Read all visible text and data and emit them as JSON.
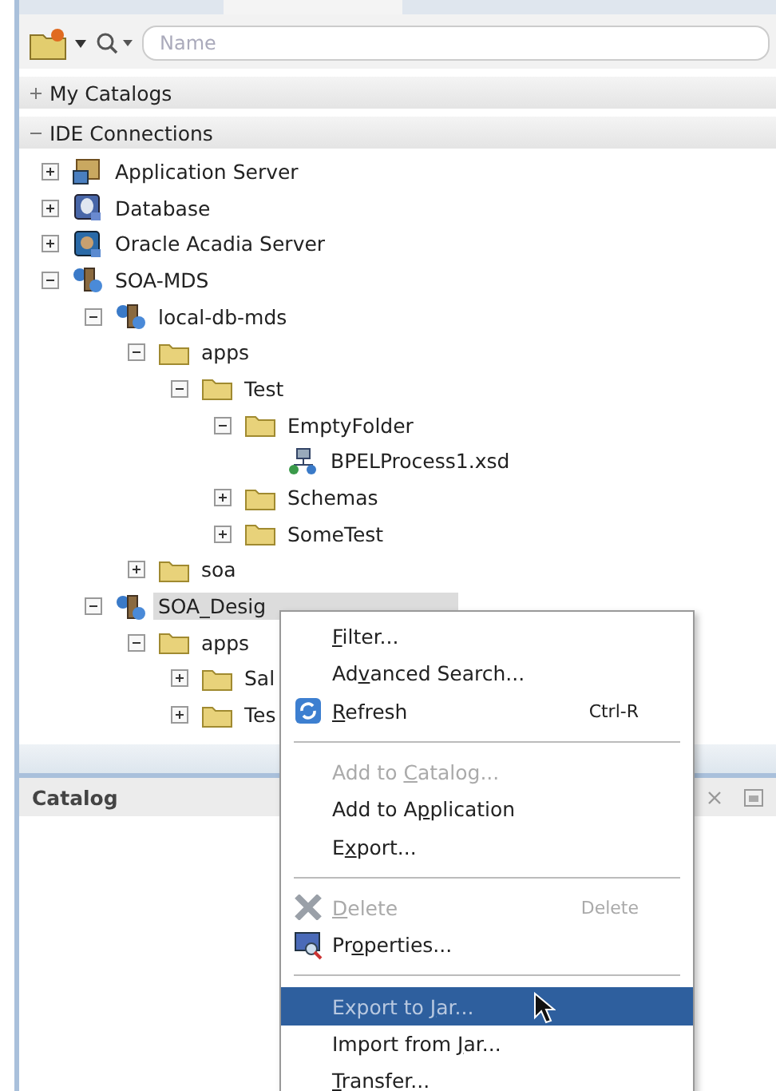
{
  "toolbar": {
    "search": {
      "placeholder": "Name"
    }
  },
  "sections": [
    {
      "title": "My Catalogs",
      "expanded": false
    },
    {
      "title": "IDE Connections",
      "expanded": true
    }
  ],
  "tree": [
    {
      "label": "Application Server",
      "kind": "server",
      "expanded": false,
      "selected": false
    },
    {
      "label": "Database",
      "kind": "database",
      "expanded": false,
      "selected": false
    },
    {
      "label": "Oracle Acadia Server",
      "kind": "appserver",
      "expanded": false,
      "selected": false
    },
    {
      "label": "SOA-MDS",
      "kind": "repository",
      "expanded": true,
      "selected": false,
      "children": [
        {
          "label": "local-db-mds",
          "kind": "connection",
          "expanded": true,
          "selected": false,
          "children": [
            {
              "label": "apps",
              "kind": "folder",
              "expanded": true,
              "selected": false,
              "children": [
                {
                  "label": "Test",
                  "kind": "folder",
                  "expanded": true,
                  "selected": false,
                  "children": [
                    {
                      "label": "EmptyFolder",
                      "kind": "folder",
                      "expanded": true,
                      "selected": false,
                      "children": [
                        {
                          "label": "BPELProcess1.xsd",
                          "kind": "schema",
                          "selected": false
                        }
                      ]
                    },
                    {
                      "label": "Schemas",
                      "kind": "folder",
                      "expanded": false,
                      "selected": false
                    },
                    {
                      "label": "SomeTest",
                      "kind": "folder",
                      "expanded": false,
                      "selected": false
                    }
                  ]
                }
              ]
            },
            {
              "label": "soa",
              "kind": "folder",
              "expanded": false,
              "selected": false
            }
          ]
        },
        {
          "label": "SOA_Desig",
          "kind": "connection",
          "expanded": true,
          "selected": true,
          "children": [
            {
              "label": "apps",
              "kind": "folder",
              "expanded": true,
              "selected": false,
              "children": [
                {
                  "label": "Sal",
                  "kind": "folder",
                  "expanded": false,
                  "selected": false
                },
                {
                  "label": "Tes",
                  "kind": "folder",
                  "expanded": false,
                  "selected": false
                }
              ]
            }
          ]
        }
      ]
    }
  ],
  "catalog_panel": {
    "title": "Catalog"
  },
  "context_menu": [
    {
      "kind": "item",
      "key": "F",
      "post": "ilter...",
      "disabled": false,
      "selected": false
    },
    {
      "kind": "item",
      "pre": "Ad",
      "key": "v",
      "post": "anced Search...",
      "disabled": false,
      "selected": false
    },
    {
      "kind": "refresh",
      "key": "R",
      "post": "efresh",
      "shortcut": "Ctrl-R",
      "disabled": false,
      "selected": false
    },
    {
      "kind": "separator"
    },
    {
      "kind": "item",
      "pre": "Add to ",
      "key": "C",
      "post": "atalog...",
      "disabled": true,
      "selected": false
    },
    {
      "kind": "item",
      "pre": "Add to A",
      "key": "p",
      "post": "plication",
      "disabled": false,
      "selected": false
    },
    {
      "kind": "item",
      "pre": "E",
      "key": "x",
      "post": "port...",
      "disabled": false,
      "selected": false
    },
    {
      "kind": "separator"
    },
    {
      "kind": "delete",
      "key": "D",
      "post": "elete",
      "shortcut": "Delete",
      "disabled": true,
      "selected": false
    },
    {
      "kind": "properties",
      "pre": "Pr",
      "key": "o",
      "post": "perties...",
      "disabled": false,
      "selected": false
    },
    {
      "kind": "separator"
    },
    {
      "kind": "item",
      "pre": "Export to ",
      "key": "J",
      "post": "ar...",
      "disabled": false,
      "selected": true
    },
    {
      "kind": "item",
      "pre": "Import from ",
      "key": "J",
      "post": "ar...",
      "disabled": false,
      "selected": false
    },
    {
      "kind": "item",
      "key": "T",
      "post": "ransfer...",
      "disabled": false,
      "selected": false
    }
  ]
}
